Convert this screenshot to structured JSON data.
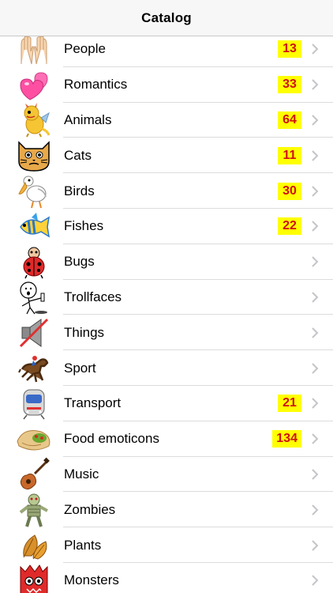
{
  "header": {
    "title": "Catalog"
  },
  "rows": [
    {
      "label": "People",
      "count": "13",
      "icon": "raised-hands-icon"
    },
    {
      "label": "Romantics",
      "count": "33",
      "icon": "two-hearts-icon"
    },
    {
      "label": "Animals",
      "count": "64",
      "icon": "dragon-icon"
    },
    {
      "label": "Cats",
      "count": "11",
      "icon": "cat-face-icon"
    },
    {
      "label": "Birds",
      "count": "30",
      "icon": "pelican-icon"
    },
    {
      "label": "Fishes",
      "count": "22",
      "icon": "tropical-fish-icon"
    },
    {
      "label": "Bugs",
      "count": "",
      "icon": "ladybug-icon"
    },
    {
      "label": "Trollfaces",
      "count": "",
      "icon": "stickman-icon"
    },
    {
      "label": "Things",
      "count": "",
      "icon": "muted-speaker-icon"
    },
    {
      "label": "Sport",
      "count": "",
      "icon": "horse-racing-icon"
    },
    {
      "label": "Transport",
      "count": "21",
      "icon": "train-icon"
    },
    {
      "label": "Food emoticons",
      "count": "134",
      "icon": "burrito-icon"
    },
    {
      "label": "Music",
      "count": "",
      "icon": "guitar-icon"
    },
    {
      "label": "Zombies",
      "count": "",
      "icon": "zombie-icon"
    },
    {
      "label": "Plants",
      "count": "",
      "icon": "fallen-leaf-icon"
    },
    {
      "label": "Monsters",
      "count": "",
      "icon": "monster-icon"
    }
  ]
}
